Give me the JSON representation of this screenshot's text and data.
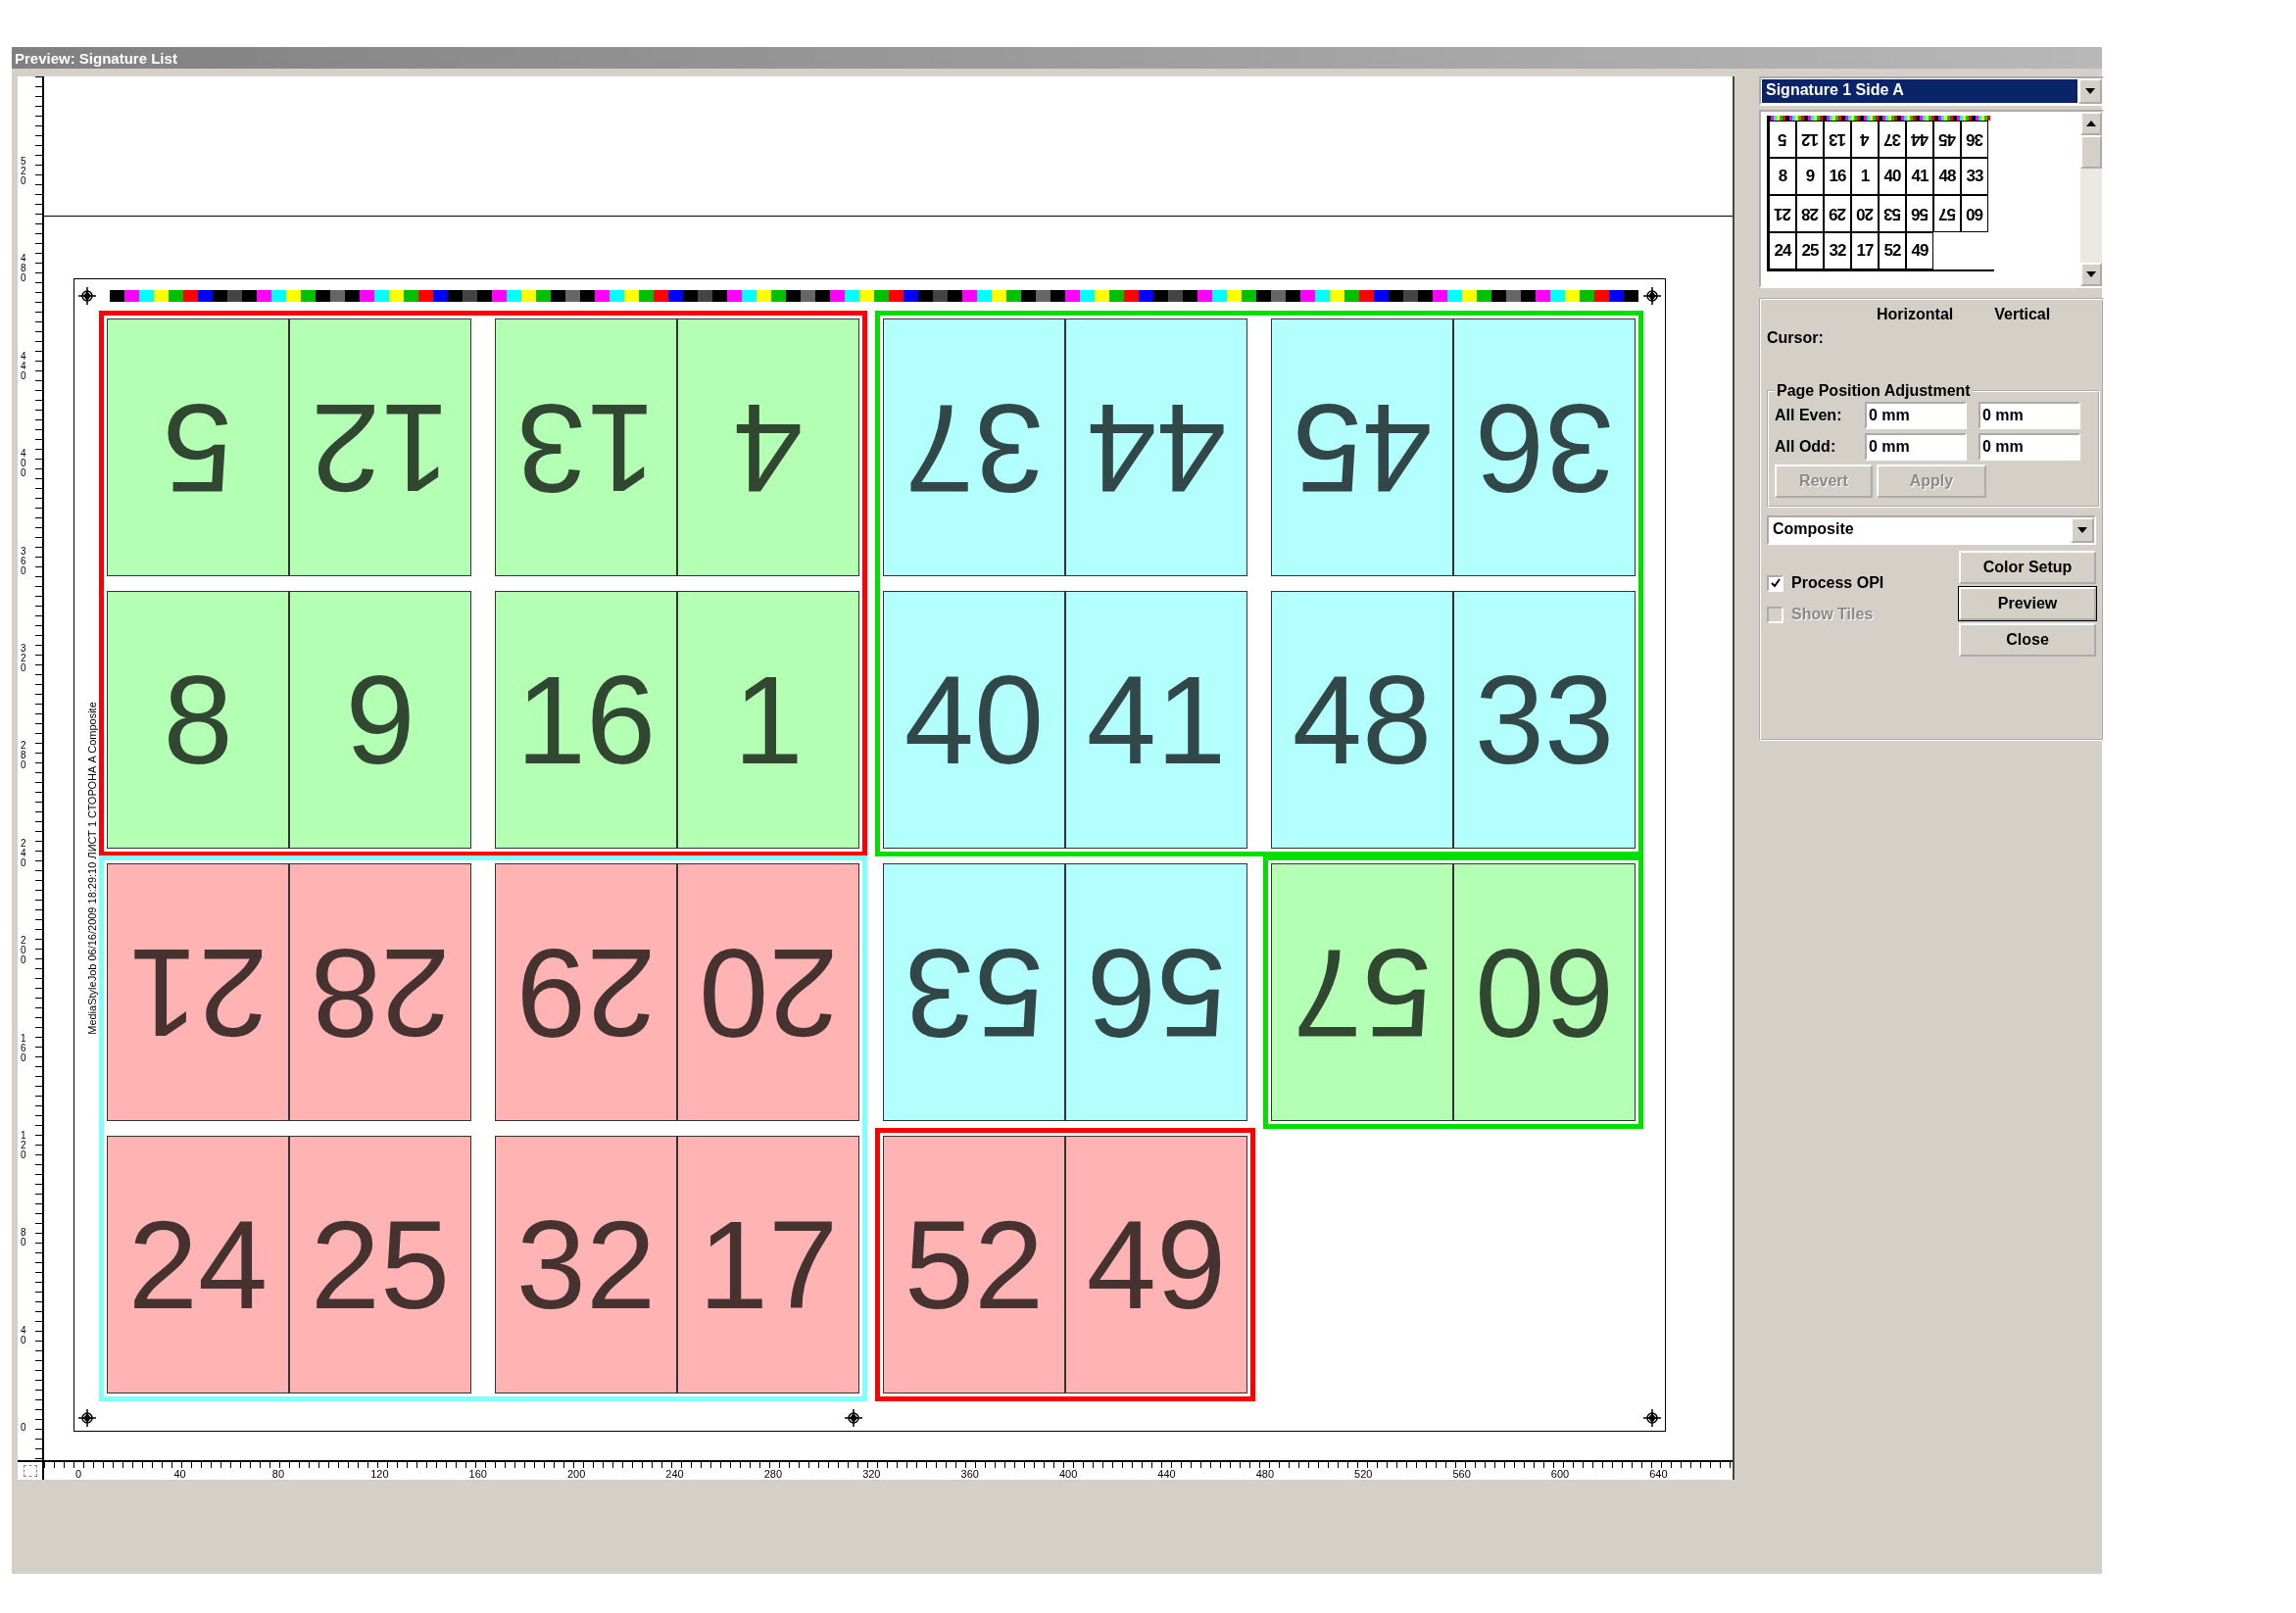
{
  "window": {
    "title": "Preview: Signature List"
  },
  "rulers": {
    "vertical": [
      "520",
      "480",
      "440",
      "400",
      "360",
      "320",
      "280",
      "240",
      "200",
      "160",
      "120",
      "80",
      "40",
      "0"
    ],
    "horizontal": [
      "0",
      "40",
      "80",
      "120",
      "160",
      "200",
      "240",
      "280",
      "320",
      "360",
      "400",
      "440",
      "480",
      "520",
      "560",
      "600",
      "640"
    ]
  },
  "sheet": {
    "slug": "MediaStyleJob 06/16/2009 18:29:10 ЛИСТ 1 СТОРОНА A Composite",
    "rows": [
      {
        "flipped": true,
        "pages": [
          {
            "number": "5",
            "color": "#b3ffb3"
          },
          {
            "number": "12",
            "color": "#b3ffb3"
          },
          {
            "number": "13",
            "color": "#b3ffb3"
          },
          {
            "number": "4",
            "color": "#b3ffb3"
          },
          {
            "number": "37",
            "color": "#b3ffff"
          },
          {
            "number": "44",
            "color": "#b3ffff"
          },
          {
            "number": "45",
            "color": "#b3ffff"
          },
          {
            "number": "36",
            "color": "#b3ffff"
          }
        ]
      },
      {
        "flipped": false,
        "pages": [
          {
            "number": "8",
            "color": "#b3ffb3"
          },
          {
            "number": "9",
            "color": "#b3ffb3"
          },
          {
            "number": "16",
            "color": "#b3ffb3"
          },
          {
            "number": "1",
            "color": "#b3ffb3"
          },
          {
            "number": "40",
            "color": "#b3ffff"
          },
          {
            "number": "41",
            "color": "#b3ffff"
          },
          {
            "number": "48",
            "color": "#b3ffff"
          },
          {
            "number": "33",
            "color": "#b3ffff"
          }
        ]
      },
      {
        "flipped": true,
        "pages": [
          {
            "number": "21",
            "color": "#ffb3b3"
          },
          {
            "number": "28",
            "color": "#ffb3b3"
          },
          {
            "number": "29",
            "color": "#ffb3b3"
          },
          {
            "number": "20",
            "color": "#ffb3b3"
          },
          {
            "number": "53",
            "color": "#b3ffff"
          },
          {
            "number": "56",
            "color": "#b3ffff"
          },
          {
            "number": "57",
            "color": "#b3ffb3"
          },
          {
            "number": "60",
            "color": "#b3ffb3"
          }
        ]
      },
      {
        "flipped": false,
        "pages": [
          {
            "number": "24",
            "color": "#ffb3b3"
          },
          {
            "number": "25",
            "color": "#ffb3b3"
          },
          {
            "number": "32",
            "color": "#ffb3b3"
          },
          {
            "number": "17",
            "color": "#ffb3b3"
          },
          {
            "number": "52",
            "color": "#ffb3b3"
          },
          {
            "number": "49",
            "color": "#ffb3b3"
          }
        ]
      }
    ],
    "groups": [
      {
        "color": "#ff0000"
      },
      {
        "color": "#00e000"
      },
      {
        "color": "#80ffff"
      },
      {
        "color": "#00e000"
      },
      {
        "color": "#ff0000"
      }
    ]
  },
  "panel": {
    "signature": "Signature 1 Side A",
    "thumbnail": {
      "rows": [
        {
          "flipped": true,
          "pages": [
            "5",
            "12",
            "13",
            "4",
            "37",
            "44",
            "45",
            "36"
          ]
        },
        {
          "flipped": false,
          "pages": [
            "8",
            "9",
            "16",
            "1",
            "40",
            "41",
            "48",
            "33"
          ]
        },
        {
          "flipped": true,
          "pages": [
            "21",
            "28",
            "29",
            "20",
            "53",
            "56",
            "57",
            "60"
          ]
        },
        {
          "flipped": false,
          "pages": [
            "24",
            "25",
            "32",
            "17",
            "52",
            "49"
          ]
        }
      ]
    },
    "columns": [
      "Horizontal",
      "Vertical"
    ],
    "cursor_label": "Cursor:",
    "adjustment": {
      "title": "Page Position Adjustment",
      "rows": [
        {
          "label": "All Even:",
          "values": [
            "0 mm",
            "0 mm"
          ]
        },
        {
          "label": "All Odd:",
          "values": [
            "0 mm",
            "0 mm"
          ]
        }
      ],
      "buttons": [
        {
          "label": "Revert",
          "disabled": true
        },
        {
          "label": "Apply",
          "disabled": true
        }
      ]
    },
    "mode": "Composite",
    "checkboxes": [
      {
        "label": "Process OPI",
        "checked": true,
        "disabled": false
      },
      {
        "label": "Show Tiles",
        "checked": false,
        "disabled": true
      }
    ],
    "buttons": [
      {
        "label": "Color Setup",
        "default": false
      },
      {
        "label": "Preview",
        "default": true
      },
      {
        "label": "Close",
        "default": false
      }
    ]
  }
}
